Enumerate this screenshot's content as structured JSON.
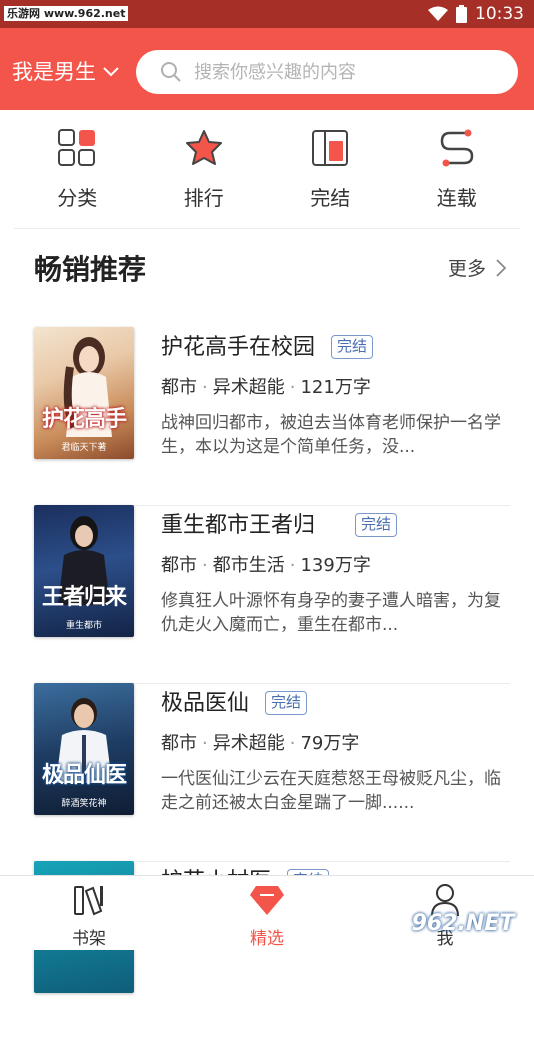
{
  "status_bar": {
    "watermark": "乐游网 www.962.net",
    "time": "10:33"
  },
  "header": {
    "gender_label": "我是男生",
    "search_placeholder": "搜索你感兴趣的内容"
  },
  "quick_nav": [
    {
      "label": "分类",
      "icon": "grid-icon"
    },
    {
      "label": "排行",
      "icon": "star-icon"
    },
    {
      "label": "完结",
      "icon": "book-complete-icon"
    },
    {
      "label": "连载",
      "icon": "serial-icon"
    }
  ],
  "section": {
    "title": "畅销推荐",
    "more": "更多"
  },
  "books": [
    {
      "title": "护花高手在校园",
      "badge": "完结",
      "category": "都市",
      "subcategory": "异术超能",
      "words": "121万字",
      "description": "战神回归都市，被迫去当体育老师保护一名学生，本以为这是个简单任务，没...",
      "cover_title": "护花高手",
      "cover_author": "君临天下著"
    },
    {
      "title": "重生都市王者归",
      "badge": "完结",
      "category": "都市",
      "subcategory": "都市生活",
      "words": "139万字",
      "description": "修真狂人叶源怀有身孕的妻子遭人暗害，为复仇走火入魔而亡，重生在都市...",
      "cover_title": "王者归来",
      "cover_author": "重生都市"
    },
    {
      "title": "极品医仙",
      "badge": "完结",
      "category": "都市",
      "subcategory": "异术超能",
      "words": "79万字",
      "description": "一代医仙江少云在天庭惹怒王母被贬凡尘，临走之前还被太白金星踹了一脚......",
      "cover_title": "极品仙医",
      "cover_author": "醉酒笑花神"
    },
    {
      "title": "护花小村医",
      "badge": "完结"
    }
  ],
  "tabbar": [
    {
      "label": "书架",
      "icon": "bookshelf-icon",
      "active": false
    },
    {
      "label": "精选",
      "icon": "diamond-icon",
      "active": true
    },
    {
      "label": "我",
      "icon": "user-icon",
      "active": false
    }
  ],
  "colors": {
    "accent": "#f4554b",
    "status_bar": "#a63027",
    "badge": "#4a6fb0"
  }
}
